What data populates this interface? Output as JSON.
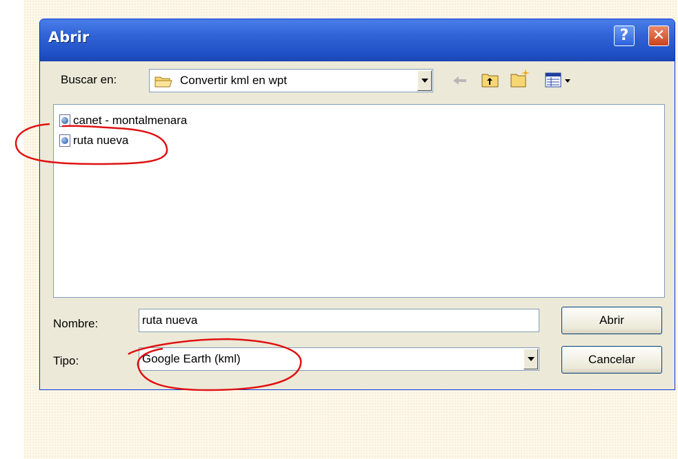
{
  "window": {
    "title": "Abrir",
    "help_label": "?",
    "close_label": "✕"
  },
  "lookin": {
    "label": "Buscar en:",
    "value": "Convertir kml en wpt"
  },
  "toolbar": {
    "icons": [
      "back-arrow-icon",
      "up-folder-icon",
      "new-folder-icon",
      "view-menu-icon"
    ]
  },
  "files": [
    {
      "name": "canet - montalmenara",
      "icon": "kml-file-icon"
    },
    {
      "name": "ruta nueva",
      "icon": "kml-file-icon"
    }
  ],
  "filename": {
    "label": "Nombre:",
    "value": "ruta nueva"
  },
  "filetype": {
    "label": "Tipo:",
    "value": "Google Earth (kml)"
  },
  "buttons": {
    "open": "Abrir",
    "cancel": "Cancelar"
  },
  "colors": {
    "titlebar": "#2f63d6",
    "annotation": "#e01010",
    "dialog_bg": "#ece9d8"
  }
}
